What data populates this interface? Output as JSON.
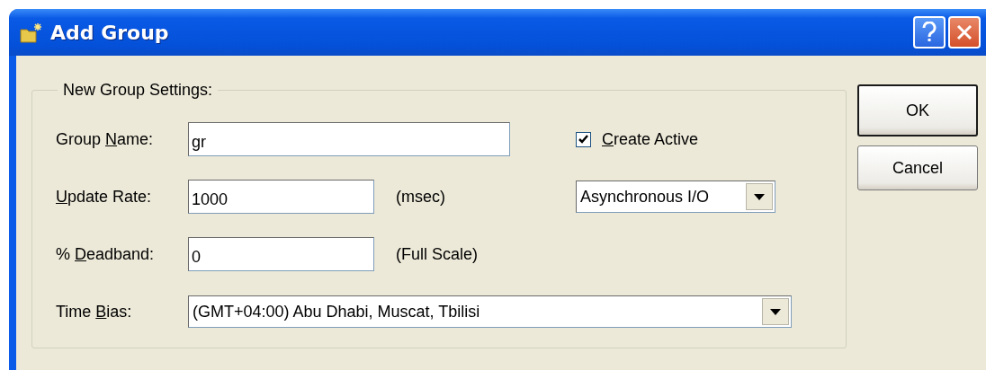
{
  "window": {
    "title": "Add Group"
  },
  "group_box": {
    "legend": "New Group Settings:",
    "group_name": {
      "label": [
        {
          "text": "Group ",
          "underlined": false
        },
        {
          "text": "N",
          "underlined": true
        },
        {
          "text": "ame:",
          "underlined": false
        }
      ],
      "value": "gr"
    },
    "create_active": {
      "label": [
        {
          "text": "C",
          "underlined": true
        },
        {
          "text": "reate Active",
          "underlined": false
        }
      ],
      "checked": true
    },
    "update_rate": {
      "label": [
        {
          "text": "U",
          "underlined": true
        },
        {
          "text": "pdate Rate:",
          "underlined": false
        }
      ],
      "value": "1000",
      "unit": "(msec)"
    },
    "mode": {
      "value": "Asynchronous I/O"
    },
    "deadband": {
      "label": [
        {
          "text": "% ",
          "underlined": false
        },
        {
          "text": "D",
          "underlined": true
        },
        {
          "text": "eadband:",
          "underlined": false
        }
      ],
      "value": "0",
      "unit": "(Full Scale)"
    },
    "time_bias": {
      "label": [
        {
          "text": "Time ",
          "underlined": false
        },
        {
          "text": "B",
          "underlined": true
        },
        {
          "text": "ias:",
          "underlined": false
        }
      ],
      "value": "(GMT+04:00) Abu Dhabi, Muscat, Tbilisi"
    }
  },
  "buttons": [
    {
      "label": "OK",
      "default": true
    },
    {
      "label": "Cancel",
      "default": false
    }
  ]
}
